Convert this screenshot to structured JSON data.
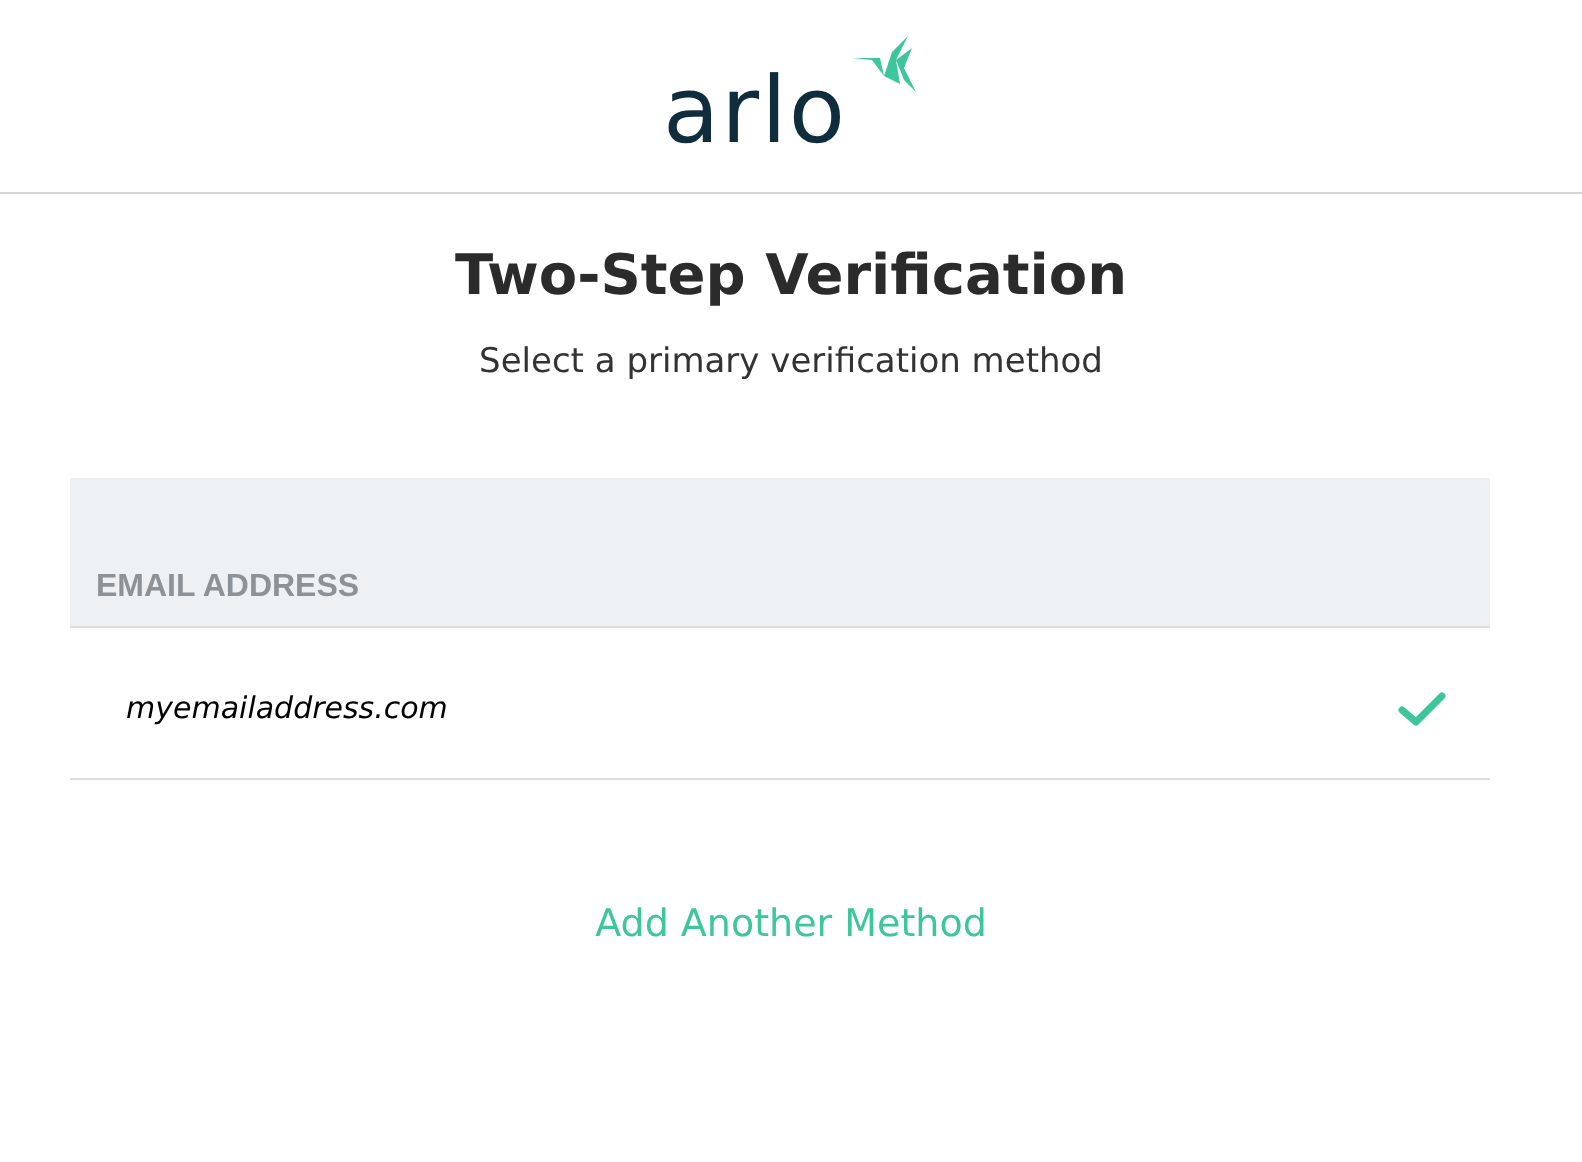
{
  "header": {
    "logo_text": "arlo"
  },
  "title": "Two-Step Verification",
  "subtitle": "Select a primary verification method",
  "section": {
    "heading": "EMAIL ADDRESS",
    "methods": [
      {
        "value": "myemailaddress.com",
        "selected": true
      }
    ]
  },
  "add_link": "Add Another Method"
}
